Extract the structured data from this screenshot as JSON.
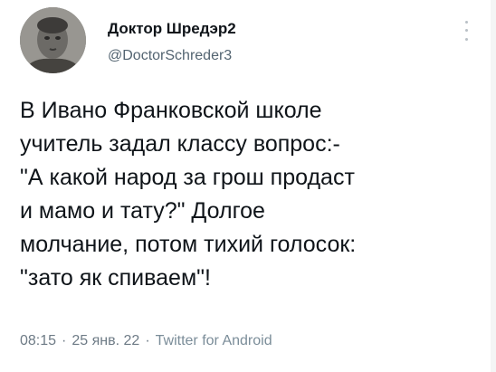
{
  "author": {
    "display_name": "Доктор Шредэр2",
    "handle": "@DoctorSchreder3"
  },
  "tweet": {
    "lines": [
      "В Ивано Франковской школе",
      "учитель задал классу вопрос:-",
      "\"А какой народ за грош продаст",
      "и мамо и тату?\" Долгое",
      "молчание, потом тихий голосок:",
      "\"зато як спиваем\"!"
    ]
  },
  "meta": {
    "time": "08:15",
    "separator": "·",
    "date": "25 янв. 22",
    "source": "Twitter for Android"
  },
  "icons": {
    "avatar": "user-avatar",
    "more": "more-options-icon"
  }
}
